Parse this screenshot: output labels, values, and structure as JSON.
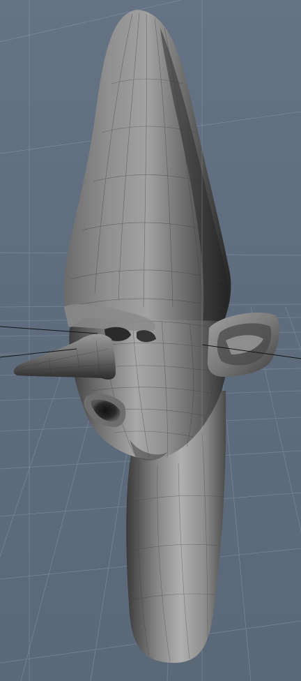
{
  "viewport": {
    "background_color": "#5e6c7d",
    "grid_color": "#7b8899",
    "axis_color": "#111418",
    "model_shade_light": "#b4b4b4",
    "model_shade_mid": "#7a7a7a",
    "model_shade_dark": "#2a2a2a",
    "wire_color": "#3c3c3c"
  }
}
